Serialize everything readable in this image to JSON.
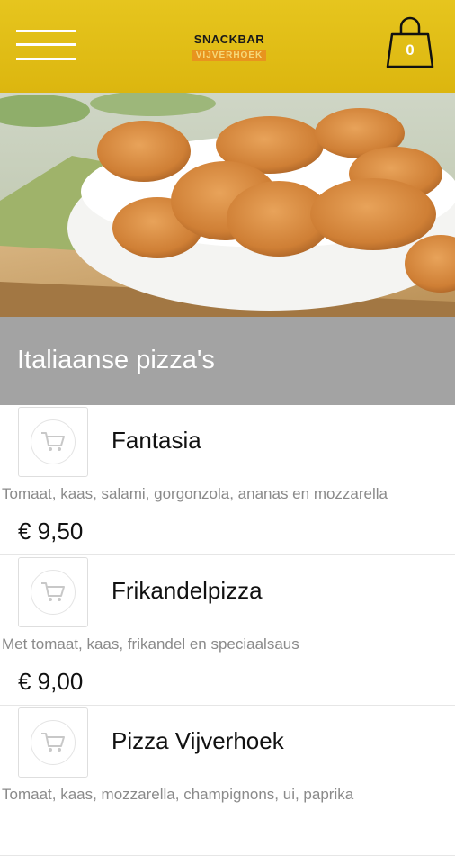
{
  "header": {
    "logo_line1": "SNACKBAR",
    "logo_line2": "VIJVERHOEK",
    "cart_count": "0",
    "menu_icon": "hamburger-menu-icon",
    "cart_icon": "shopping-bag-icon",
    "accent_color": "#dcb60f"
  },
  "hero": {
    "alt": "Bowl of chicken nuggets"
  },
  "category": {
    "title": "Italiaanse pizza's",
    "bar_color": "#a3a3a3"
  },
  "items": [
    {
      "name": "Fantasia",
      "description": "Tomaat, kaas, salami, gorgonzola, ananas en mozzarella",
      "price": "€ 9,50",
      "icon": "add-to-cart-icon"
    },
    {
      "name": "Frikandelpizza",
      "description": "Met tomaat, kaas, frikandel en speciaalsaus",
      "price": "€ 9,00",
      "icon": "add-to-cart-icon"
    },
    {
      "name": "Pizza Vijverhoek",
      "description": "Tomaat, kaas, mozzarella, champignons, ui, paprika",
      "price": "",
      "icon": "add-to-cart-icon"
    }
  ]
}
